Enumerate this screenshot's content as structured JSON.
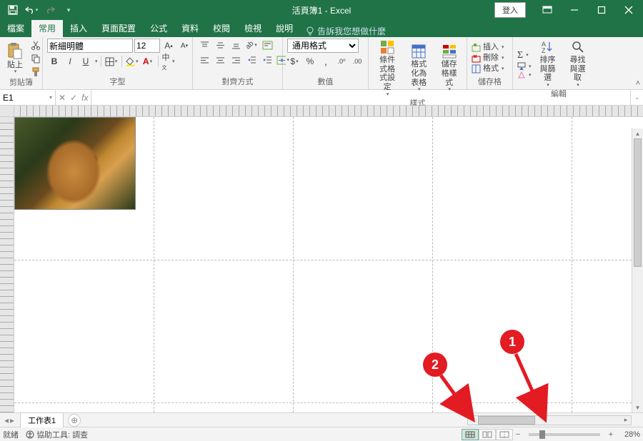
{
  "titlebar": {
    "title_doc": "活頁簿1",
    "title_app": "Excel",
    "signin": "登入"
  },
  "tabs": {
    "file": "檔案",
    "home": "常用",
    "insert": "插入",
    "pagelayout": "頁面配置",
    "formulas": "公式",
    "data": "資料",
    "review": "校閱",
    "view": "檢視",
    "help": "說明",
    "tellme": "告訴我您想做什麼"
  },
  "ribbon": {
    "clipboard": {
      "label": "剪貼簿",
      "paste": "貼上"
    },
    "font": {
      "label": "字型",
      "name": "新細明體",
      "size": "12",
      "bold": "B",
      "italic": "I",
      "underline": "U"
    },
    "align": {
      "label": "對齊方式"
    },
    "number": {
      "label": "數值",
      "format": "通用格式"
    },
    "styles": {
      "label": "樣式",
      "cond": "條件式格式設定",
      "astable": "格式化為表格",
      "cellstyles": "儲存格樣式"
    },
    "cells": {
      "label": "儲存格",
      "insert": "插入",
      "delete": "刪除",
      "format": "格式"
    },
    "editing": {
      "label": "編輯",
      "sortfilter": "排序與篩選",
      "findselect": "尋找與選取"
    }
  },
  "formulabar": {
    "namebox": "E1",
    "fx": "fx"
  },
  "sheets": {
    "sheet1": "工作表1"
  },
  "statusbar": {
    "ready": "就緒",
    "accessibility": "協助工具: 調查",
    "zoom": "28%"
  },
  "annotations": {
    "one": "1",
    "two": "2"
  }
}
